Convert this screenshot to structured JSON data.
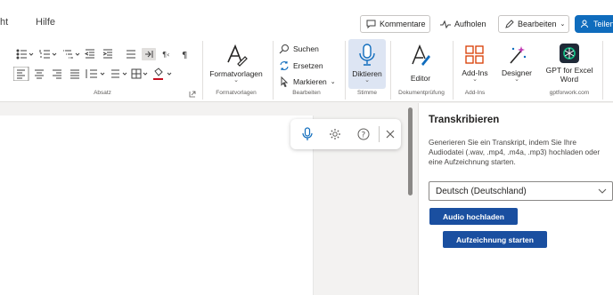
{
  "tabs": {
    "partial": "ht",
    "help": "Hilfe"
  },
  "topbar": {
    "comments": "Kommentare",
    "catchup": "Aufholen",
    "editing": "Bearbeiten",
    "share": "Teilen"
  },
  "ribbon": {
    "groups": {
      "paragraph": "Absatz",
      "styles": "Formatvorlagen",
      "editing": "Bearbeiten",
      "voice": "Stimme",
      "proofing": "Dokumentprüfung",
      "addins": "Add-Ins",
      "gpt": "gptforwork.com"
    },
    "styles_button": "Formatvorlagen",
    "find": "Suchen",
    "replace": "Ersetzen",
    "select": "Markieren",
    "dictate": "Diktieren",
    "editor": "Editor",
    "addins_button": "Add-Ins",
    "designer": "Designer",
    "gpt_line1": "GPT for Excel",
    "gpt_line2": "Word"
  },
  "pane": {
    "title": "Transkribieren",
    "description": "Generieren Sie ein Transkript, indem Sie Ihre Audiodatei (.wav, .mp4, .m4a, .mp3) hochladen oder eine Aufzeichnung starten.",
    "language": "Deutsch (Deutschland)",
    "upload": "Audio hochladen",
    "record": "Aufzeichnung starten"
  },
  "colors": {
    "accent": "#1a4fa0",
    "share": "#0f6cbd",
    "dictate_active": "#dde5f3",
    "addins": "#d83b01"
  }
}
